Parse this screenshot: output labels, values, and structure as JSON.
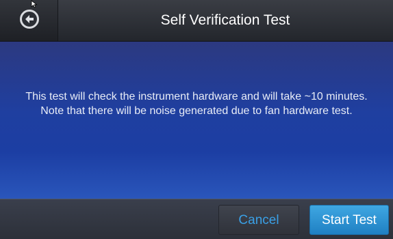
{
  "header": {
    "title": "Self Verification Test",
    "back_icon": "arrow-left-circle"
  },
  "message": {
    "line1": "This test will check the instrument hardware and will take ~10 minutes.",
    "line2": "Note that there will be noise generated due to fan hardware test."
  },
  "footer": {
    "cancel_label": "Cancel",
    "start_label": "Start Test"
  },
  "colors": {
    "accent": "#2f95d8",
    "cancel_text": "#3aa0e6",
    "content_bg": "#1f3fa0"
  }
}
